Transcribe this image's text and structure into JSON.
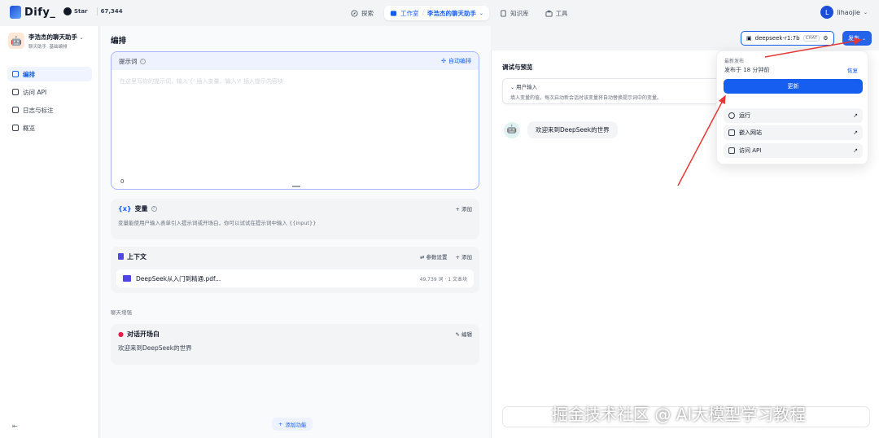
{
  "header": {
    "brand": "Dify_",
    "github_star": "Star",
    "github_count": "67,344",
    "nav": {
      "explore": "探索",
      "studio": "工作室",
      "app_name": "李浩杰的聊天助手",
      "knowledge": "知识库",
      "tools": "工具"
    },
    "user": {
      "initial": "L",
      "name": "lihaojie"
    }
  },
  "sidebar": {
    "app_name": "李浩杰的聊天助手",
    "app_type": "聊天助手",
    "app_mode": "基础编排",
    "items": [
      {
        "label": "编排",
        "icon": "orchestrate-icon"
      },
      {
        "label": "访问 API",
        "icon": "terminal-icon"
      },
      {
        "label": "日志与标注",
        "icon": "logs-icon"
      },
      {
        "label": "概览",
        "icon": "overview-icon"
      }
    ],
    "collapse_glyph": "⇤"
  },
  "main": {
    "title": "编排",
    "prompt": {
      "label": "提示词",
      "auto_label": "自动编排",
      "placeholder": "在这里写你的提示词，输入'{' 插入变量、输入'/' 插入提示内容块",
      "count": "0"
    },
    "variables": {
      "title": "变量",
      "add": "添加",
      "desc": "变量能使用户输入表单引入提示词或开场白，你可以试试在提示词中输入 {{input}}"
    },
    "context": {
      "title": "上下文",
      "params": "参数设置",
      "add": "添加",
      "doc_name": "DeepSeek从入门到精通.pdf...",
      "doc_meta": "49,739 词 · 1 文本块"
    },
    "enhance_label": "聊天增强",
    "opening": {
      "title": "对话开场白",
      "edit": "编辑",
      "text": "欢迎来到DeepSeek的世界"
    },
    "add_feature": "添加功能"
  },
  "preview": {
    "title": "调试与预览",
    "user_input_title": "用户输入",
    "user_input_desc": "填入变量的值，每次启动新会话时该变量将自动替换提示词中的变量。",
    "bot_message": "欢迎来到DeepSeek的世界"
  },
  "toolbar": {
    "model_name": "deepseek-r1:7b",
    "model_tag": "CHAT",
    "publish_label": "发布"
  },
  "publish_popup": {
    "label": "最新发布",
    "time": "发布于 18 分钟前",
    "restore": "恢复",
    "update": "更新",
    "items": [
      {
        "label": "运行",
        "arrow": "↗"
      },
      {
        "label": "嵌入网站",
        "arrow": "↗"
      },
      {
        "label": "访问 API",
        "arrow": "↗"
      }
    ]
  },
  "watermark": "掘金技术社区 @ AI大模型学习教程",
  "colors": {
    "accent": "#155eef",
    "annotation_arrow": "#e53935"
  }
}
